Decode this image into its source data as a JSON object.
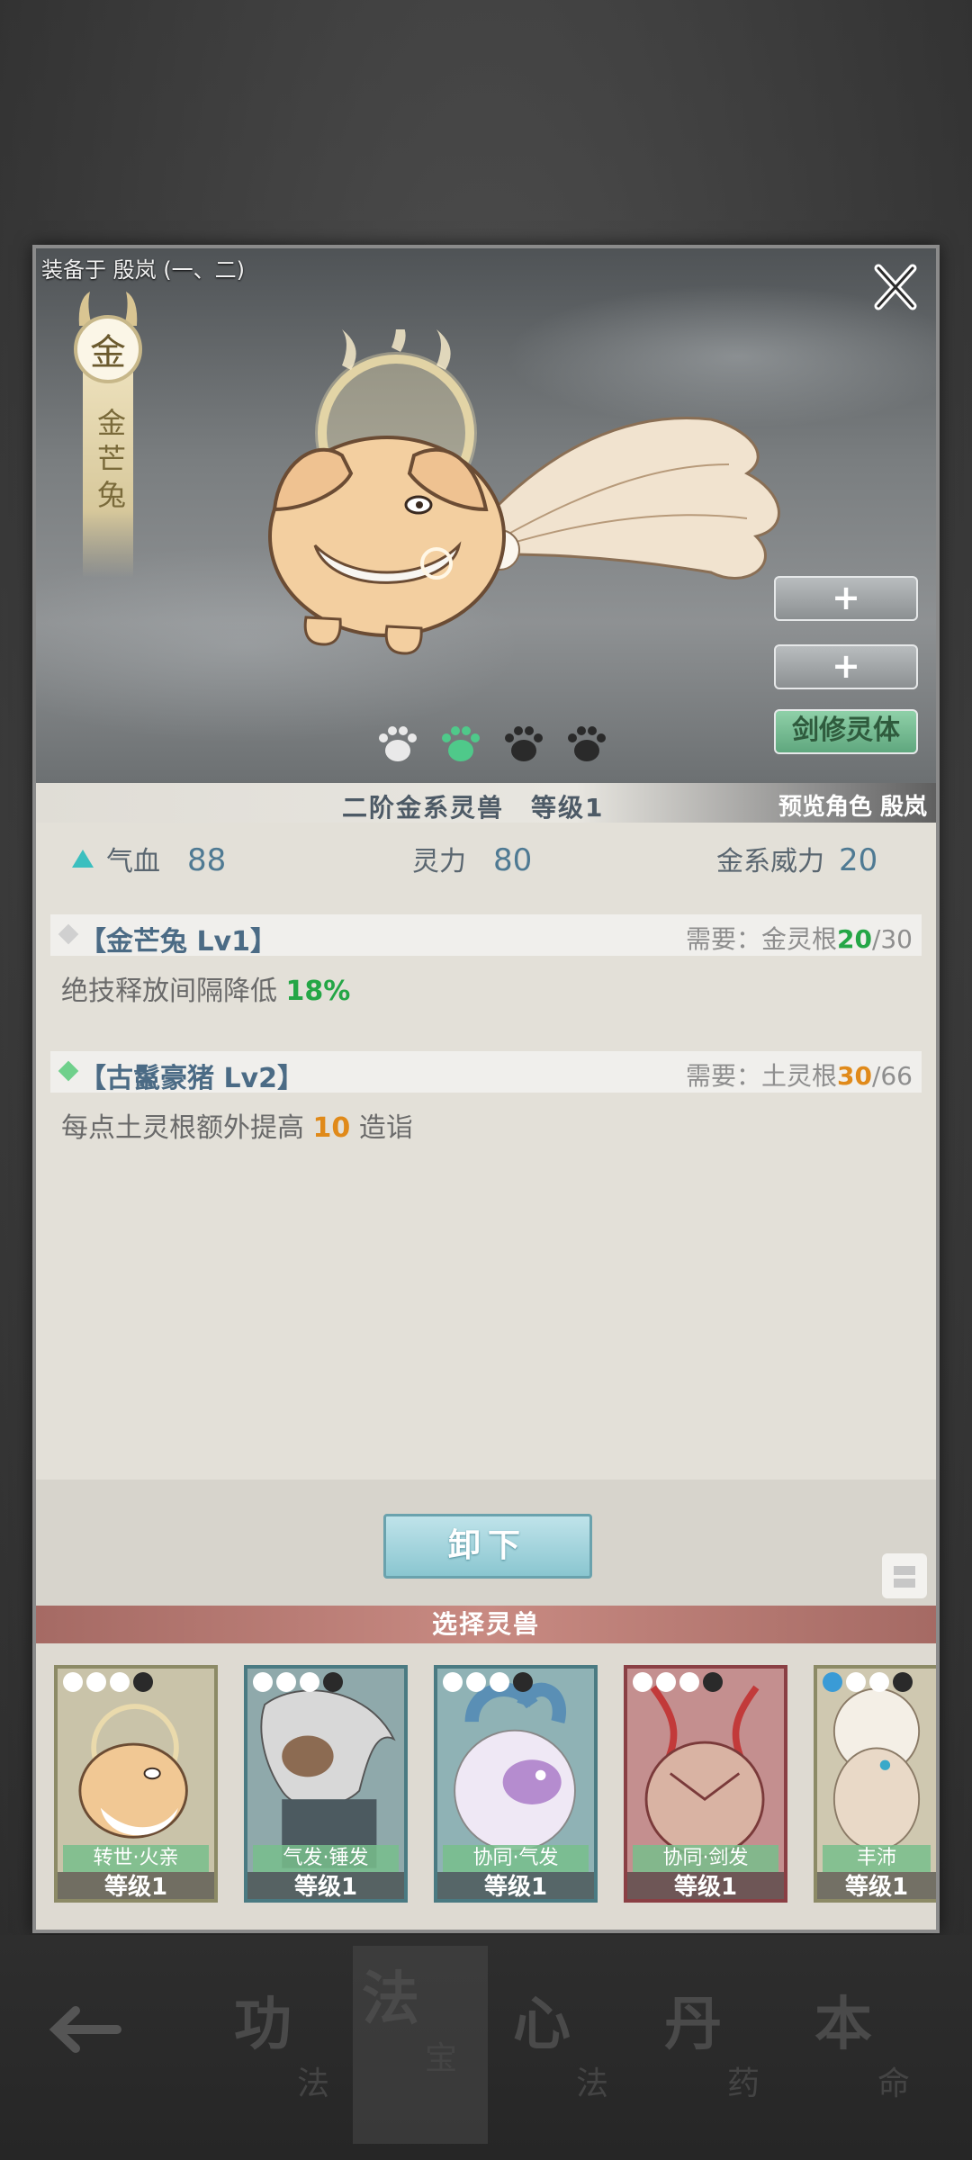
{
  "header": {
    "equipped_label": "装备于 殷岚 (一、二)",
    "close_icon": "close-icon"
  },
  "pet": {
    "element": "金",
    "name_vertical": [
      "金",
      "芒",
      "兔"
    ],
    "art": "golden-rabbit-illustration"
  },
  "side_buttons": {
    "add1": "+",
    "add2": "+",
    "body": "剑修灵体"
  },
  "paws": [
    {
      "state": "white"
    },
    {
      "state": "green"
    },
    {
      "state": "dark"
    },
    {
      "state": "dark"
    }
  ],
  "tier": {
    "text": "二阶金系灵兽　等级1",
    "preview": "预览角色 殷岚"
  },
  "stats": [
    {
      "label": "气血",
      "value": "88"
    },
    {
      "label": "灵力",
      "value": "80"
    },
    {
      "label": "金系威力",
      "value": "20"
    }
  ],
  "skills": [
    {
      "title": "【金芒兔 Lv1】",
      "req_label": "需要：",
      "req_root": "金灵根",
      "req_cur": "20",
      "req_max": "/30",
      "desc_prefix": "绝技释放间隔降低 ",
      "desc_value": "18%",
      "desc_suffix": "",
      "diamond_color": "#d0d0d0",
      "cur_color": "#24a646"
    },
    {
      "title": "【古鬣豪猪 Lv2】",
      "req_label": "需要：",
      "req_root": "土灵根",
      "req_cur": "30",
      "req_max": "/66",
      "desc_prefix": "每点土灵根额外提高 ",
      "desc_value": "10",
      "desc_suffix": " 造诣",
      "diamond_color": "#6fd08b",
      "cur_color": "#e08a1a"
    }
  ],
  "unload_button": "卸下",
  "select_header": "选择灵兽",
  "cards": [
    {
      "trait": "转世·火亲",
      "level": "等级1",
      "border": "#8c8a66",
      "bg": "#c9c3a9"
    },
    {
      "trait": "气发·锤发",
      "level": "等级1",
      "border": "#4a7a82",
      "bg": "#8fa9ab"
    },
    {
      "trait": "协同·气发",
      "level": "等级1",
      "border": "#4a7a82",
      "bg": "#8fb2b5"
    },
    {
      "trait": "协同·剑发",
      "level": "等级1",
      "border": "#8a3f44",
      "bg": "#c48f8f"
    },
    {
      "trait": "丰沛",
      "level": "等级1",
      "border": "#8c8a66",
      "bg": "#cfc8b0"
    }
  ],
  "nav": [
    {
      "big": "功",
      "small": "法"
    },
    {
      "big": "法",
      "small": "宝"
    },
    {
      "big": "心",
      "small": "法"
    },
    {
      "big": "丹",
      "small": "药"
    },
    {
      "big": "本",
      "small": "命"
    }
  ]
}
